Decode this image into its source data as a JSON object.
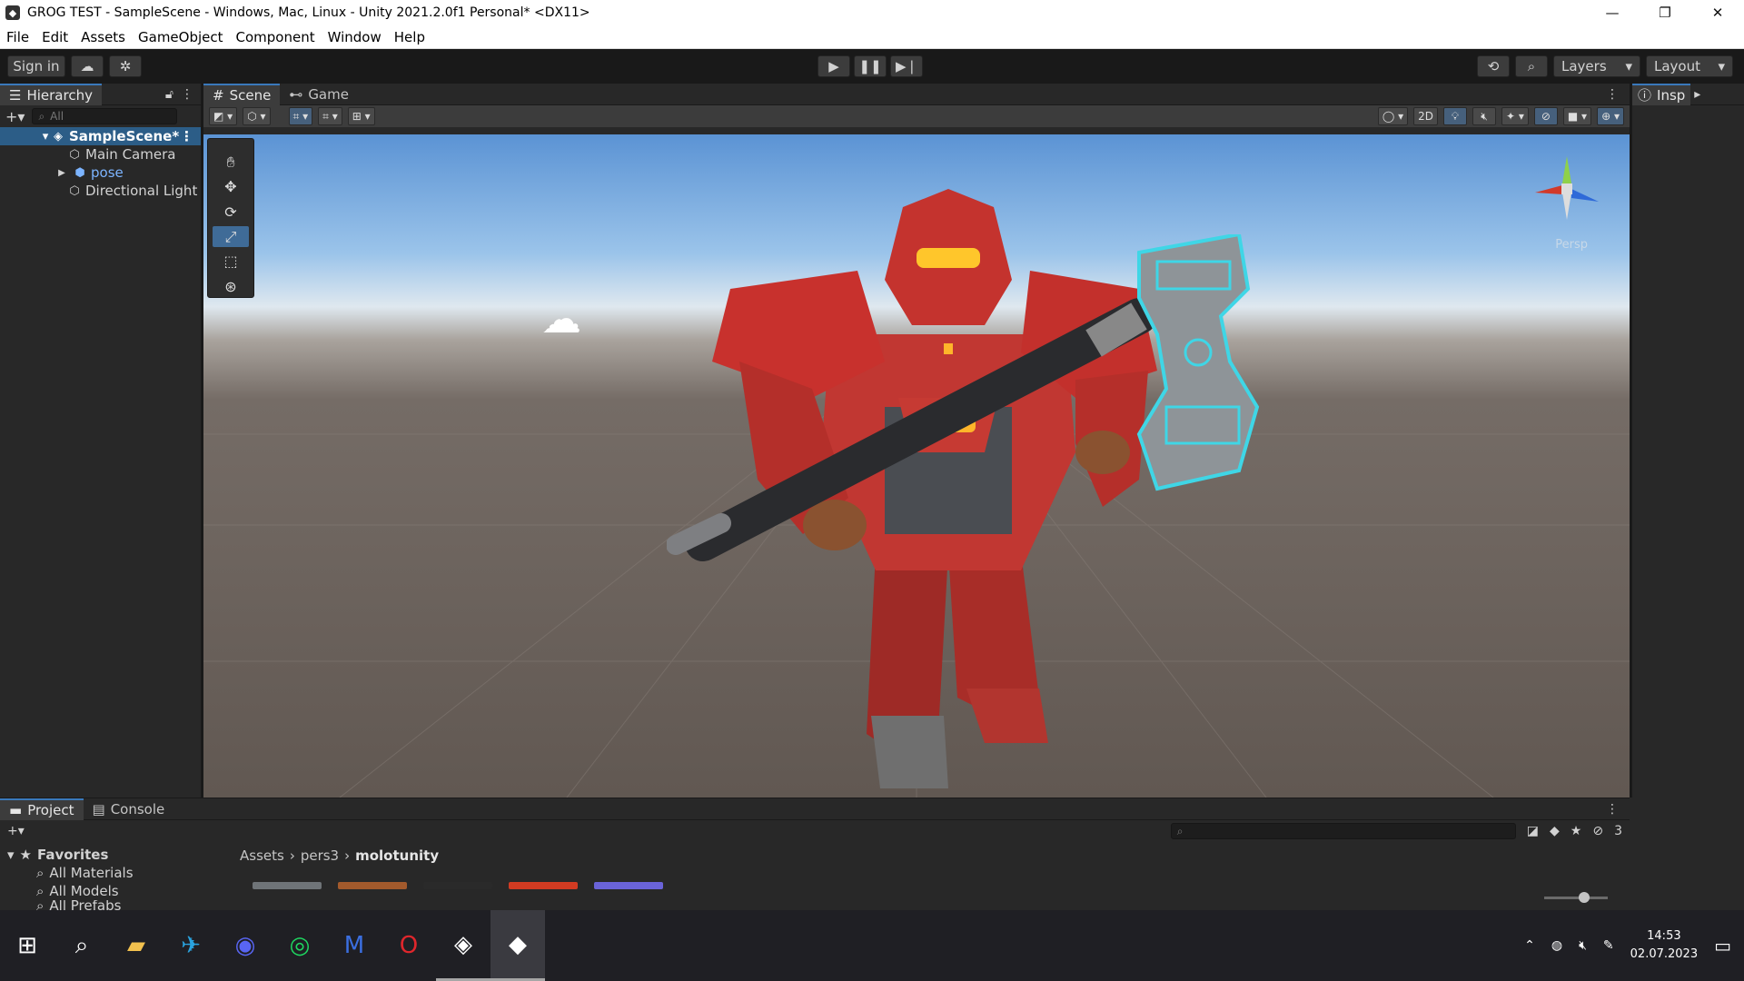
{
  "window": {
    "title": "GROG TEST - SampleScene - Windows, Mac, Linux - Unity 2021.2.0f1 Personal* <DX11>",
    "controls": [
      "—",
      "❐",
      "✕"
    ]
  },
  "menu": [
    "File",
    "Edit",
    "Assets",
    "GameObject",
    "Component",
    "Window",
    "Help"
  ],
  "toolbar": {
    "sign_in": "Sign in",
    "layers": "Layers",
    "layout": "Layout"
  },
  "hierarchy": {
    "tab": "Hierarchy",
    "search_placeholder": "All",
    "scene": "SampleScene*",
    "items": [
      "Main Camera",
      "pose",
      "Directional Light"
    ]
  },
  "scene": {
    "tabs": [
      "Scene",
      "Game"
    ],
    "toggle_2d": "2D",
    "gizmo_label": "Persp"
  },
  "inspector": {
    "tab": "Insp"
  },
  "project": {
    "tabs": [
      "Project",
      "Console"
    ],
    "favorites": "Favorites",
    "favorite_items": [
      "All Materials",
      "All Models",
      "All Prefabs"
    ],
    "breadcrumb": [
      "Assets",
      "pers3",
      "molotunity"
    ],
    "hidden_count": "3",
    "thumb_colors": [
      "#6f7478",
      "#a35a2c",
      "#2a2a2a",
      "#d23b22",
      "#6a63d8"
    ]
  },
  "taskbar": {
    "time": "14:53",
    "date": "02.07.2023"
  },
  "colors": {
    "accent": "#3a79bb",
    "selection": "#2c5d87",
    "armor": "#c8312d",
    "hammer_glow": "#3fd6e6"
  }
}
